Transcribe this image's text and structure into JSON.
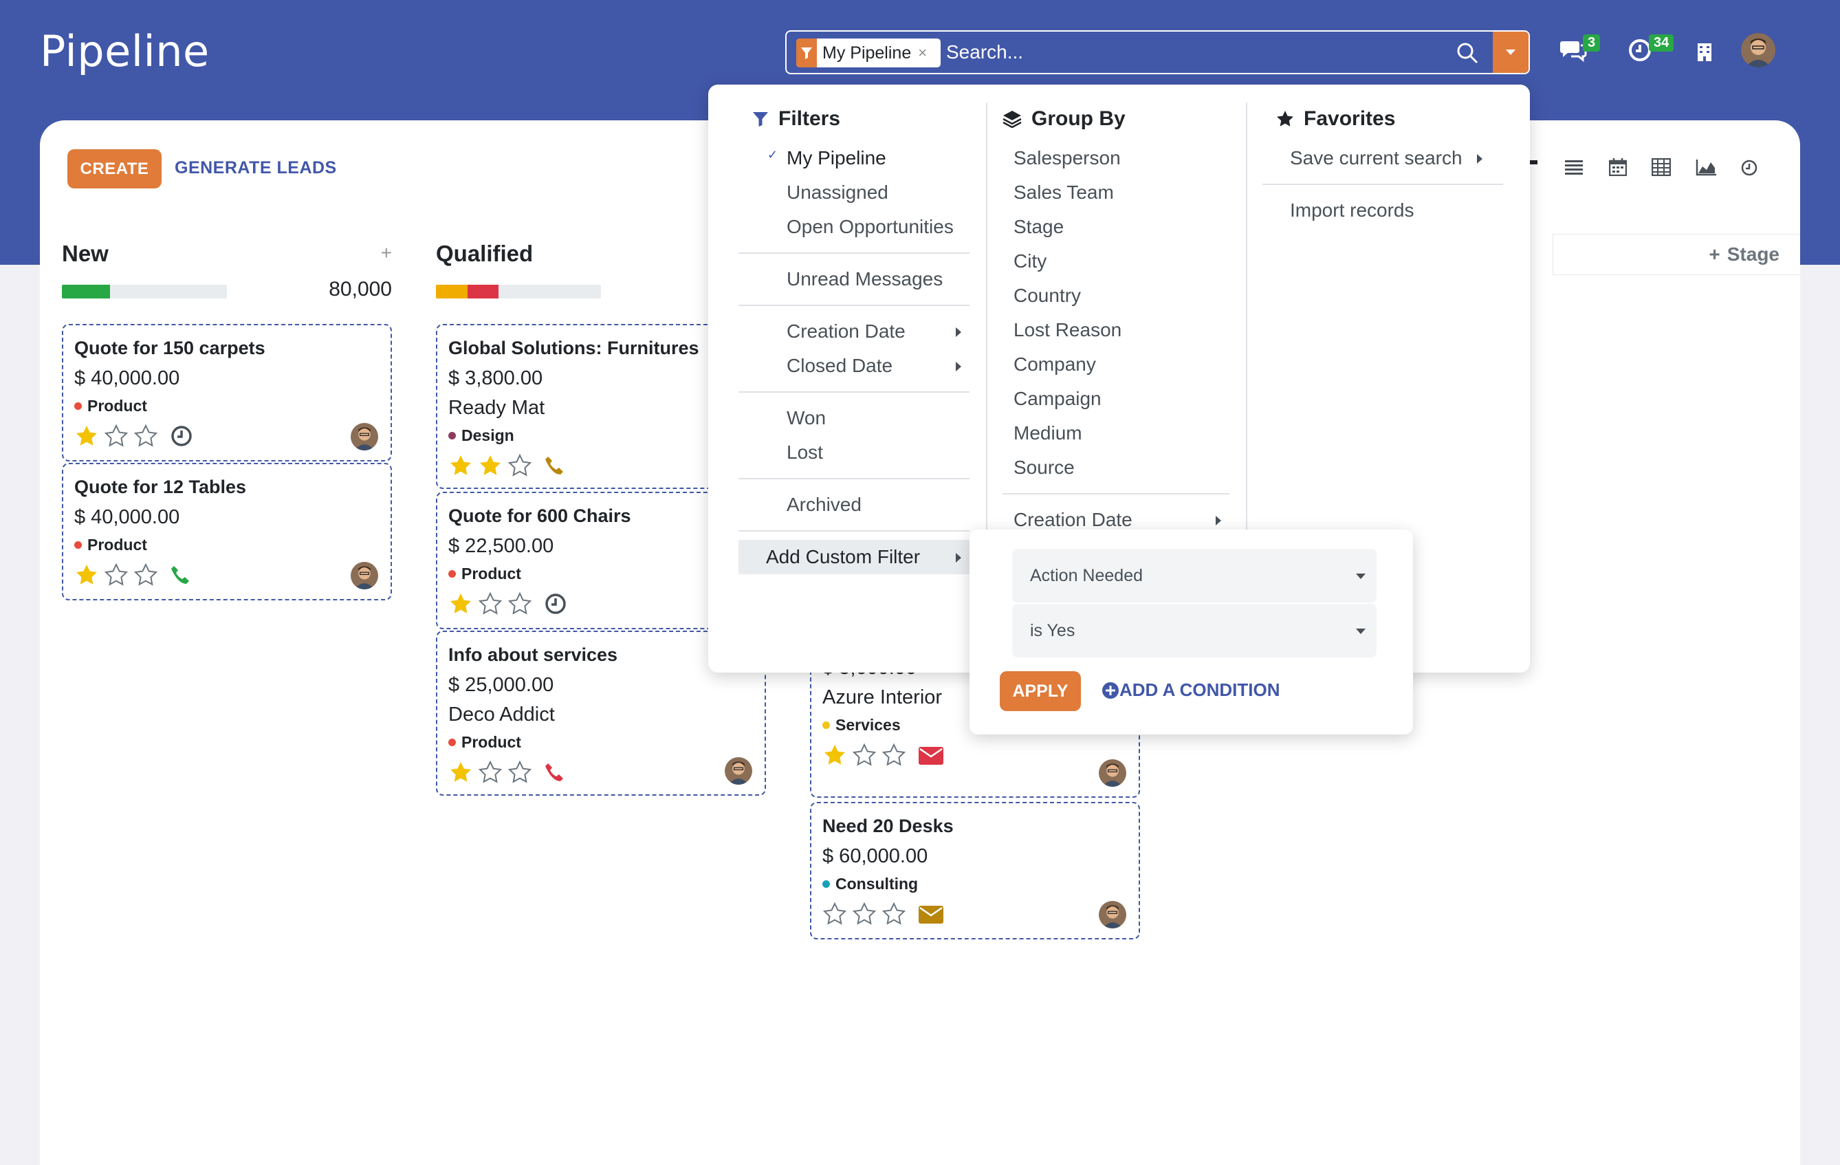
{
  "app": {
    "title": "Pipeline"
  },
  "search": {
    "facet_label": "My Pipeline",
    "placeholder": "Search..."
  },
  "systray": {
    "messages_count": "3",
    "activities_count": "34"
  },
  "control": {
    "create_label": "CREATE",
    "generate_label": "GENERATE LEADS"
  },
  "columns": [
    {
      "title": "New",
      "total": "80,000",
      "progress": [
        {
          "color": "#28a745",
          "fraction": 0.29
        }
      ],
      "cards": [
        {
          "name": "Quote for 150 carpets",
          "amount": "$ 40,000.00",
          "tag": "Product",
          "tag_color": "#e74c3c",
          "stars": 1,
          "activity": "clock"
        },
        {
          "name": "Quote for 12 Tables",
          "amount": "$ 40,000.00",
          "tag": "Product",
          "tag_color": "#e74c3c",
          "stars": 1,
          "activity": "phone-green"
        }
      ]
    },
    {
      "title": "Qualified",
      "total": "",
      "progress": [
        {
          "color": "#f0ad00",
          "fraction": 0.19
        },
        {
          "color": "#dc3545",
          "fraction": 0.19
        }
      ],
      "cards": [
        {
          "name": "Global Solutions: Furnitures",
          "amount": "$ 3,800.00",
          "partner": "Ready Mat",
          "tag": "Design",
          "tag_color": "#8e3b5e",
          "stars": 2,
          "activity": "phone-amber"
        },
        {
          "name": "Quote for 600 Chairs",
          "amount": "$ 22,500.00",
          "tag": "Product",
          "tag_color": "#e74c3c",
          "stars": 1,
          "activity": "clock"
        },
        {
          "name": "Info about services",
          "amount": "$ 25,000.00",
          "partner": "Deco Addict",
          "tag": "Product",
          "tag_color": "#e74c3c",
          "stars": 1,
          "activity": "phone-red"
        }
      ]
    },
    {
      "title": "",
      "cards": [
        {
          "name": "",
          "amount": "$ 5,600.00",
          "partner": "Azure Interior",
          "tag": "Services",
          "tag_color": "#f0c419",
          "stars": 1,
          "activity": "mail-red"
        },
        {
          "name": "Need 20 Desks",
          "amount": "$ 60,000.00",
          "tag": "Consulting",
          "tag_color": "#17a2b8",
          "stars": 0,
          "activity": "mail-amber"
        }
      ]
    }
  ],
  "add_stage": "Stage",
  "dropdown": {
    "filters": {
      "title": "Filters",
      "items": [
        "My Pipeline",
        "Unassigned",
        "Open Opportunities",
        "Unread Messages",
        "Creation Date",
        "Closed Date",
        "Won",
        "Lost",
        "Archived",
        "Add Custom Filter"
      ]
    },
    "groupby": {
      "title": "Group By",
      "items": [
        "Salesperson",
        "Sales Team",
        "Stage",
        "City",
        "Country",
        "Lost Reason",
        "Company",
        "Campaign",
        "Medium",
        "Source",
        "Creation Date"
      ]
    },
    "favorites": {
      "title": "Favorites",
      "items": [
        "Save current search",
        "Import records"
      ]
    }
  },
  "custom_filter": {
    "field": "Action Needed",
    "operator": "is Yes",
    "apply_label": "APPLY",
    "add_condition_label": "ADD A CONDITION"
  },
  "colors": {
    "primary": "#4157a8",
    "accent": "#e07b39"
  }
}
